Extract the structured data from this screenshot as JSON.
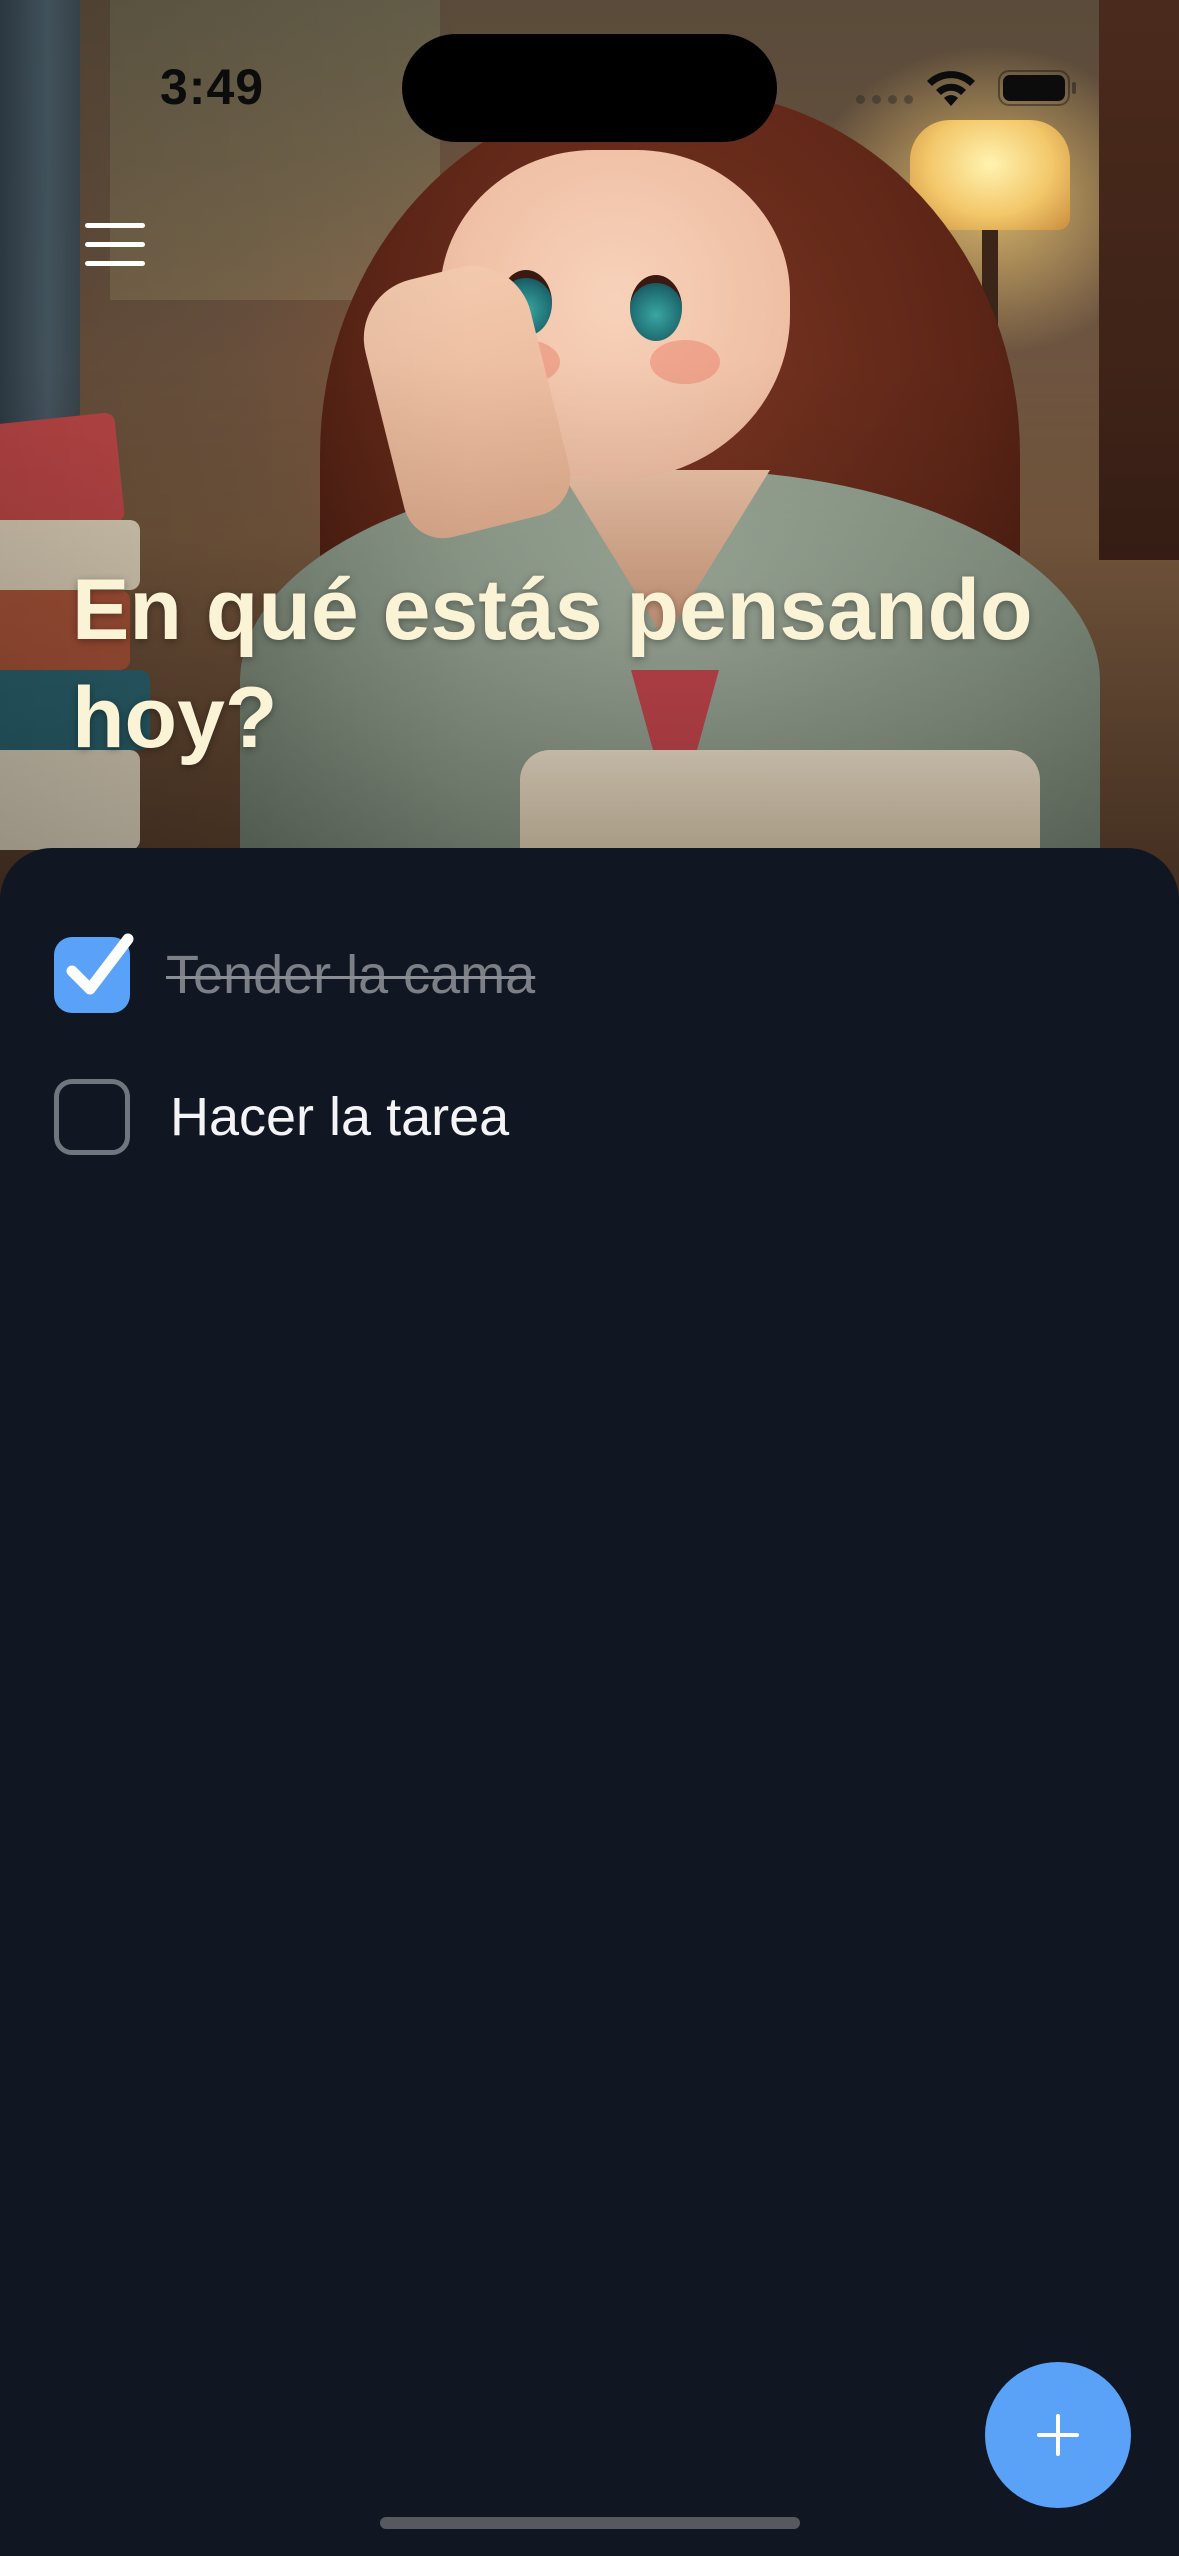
{
  "status_bar": {
    "time": "3:49",
    "icons": [
      "wifi-icon",
      "battery-icon"
    ]
  },
  "header": {
    "menu_icon": "hamburger-menu-icon",
    "title": "En qué estás pensando hoy?",
    "background_image": "anime girl reading with books and lamp illustration"
  },
  "tasks": [
    {
      "label": "Tender la cama",
      "completed": true
    },
    {
      "label": "Hacer la tarea",
      "completed": false
    }
  ],
  "fab": {
    "icon": "plus-icon"
  },
  "colors": {
    "background": "#111722",
    "accent": "#5aa2f8",
    "title": "#fbf3d6",
    "task_text": "#f4f4f6",
    "task_done_text": "#7c7f86",
    "checkbox_border": "#70757e"
  }
}
